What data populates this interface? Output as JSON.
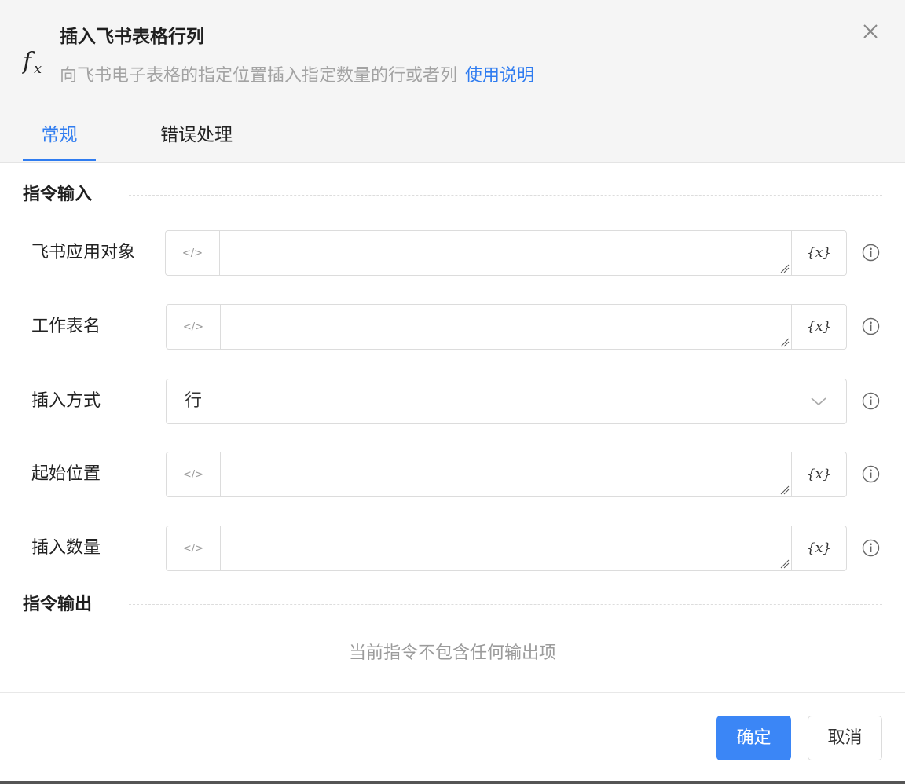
{
  "dialog": {
    "title": "插入飞书表格行列",
    "description": "向飞书电子表格的指定位置插入指定数量的行或者列",
    "help_link": "使用说明",
    "icon": "fx-icon"
  },
  "tabs": [
    {
      "label": "常规",
      "active": true
    },
    {
      "label": "错误处理",
      "active": false
    }
  ],
  "input_section": {
    "title": "指令输入",
    "fields": [
      {
        "label": "飞书应用对象",
        "type": "expression",
        "value": "",
        "code_icon": "</>",
        "var_icon": "{x}"
      },
      {
        "label": "工作表名",
        "type": "expression",
        "value": "",
        "code_icon": "</>",
        "var_icon": "{x}"
      },
      {
        "label": "插入方式",
        "type": "select",
        "value": "行"
      },
      {
        "label": "起始位置",
        "type": "expression",
        "value": "",
        "code_icon": "</>",
        "var_icon": "{x}"
      },
      {
        "label": "插入数量",
        "type": "expression",
        "value": "",
        "code_icon": "</>",
        "var_icon": "{x}"
      }
    ]
  },
  "output_section": {
    "title": "指令输出",
    "empty_text": "当前指令不包含任何输出项"
  },
  "footer": {
    "ok_label": "确定",
    "cancel_label": "取消"
  },
  "colors": {
    "accent": "#2f7cf0",
    "primary_button": "#3b86f6",
    "header_bg": "#f5f5f5"
  }
}
